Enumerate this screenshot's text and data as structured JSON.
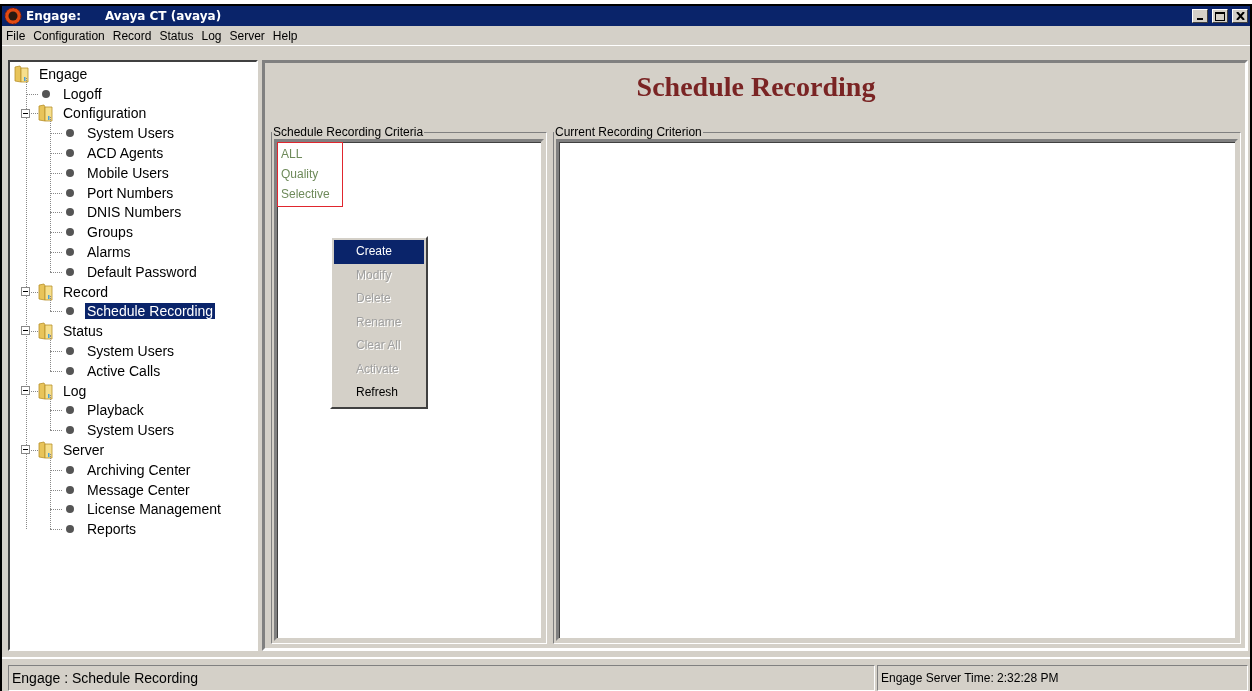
{
  "window": {
    "title": "Engage:",
    "subtitle": "Avaya CT (avaya)"
  },
  "menu": [
    "File",
    "Configuration",
    "Record",
    "Status",
    "Log",
    "Server",
    "Help"
  ],
  "tree": [
    {
      "label": "Engage",
      "kind": "folder",
      "selected": false,
      "children": [
        {
          "label": "Logoff",
          "kind": "leaf",
          "selected": false
        },
        {
          "label": "Configuration",
          "kind": "folder",
          "expanded": true,
          "selected": false,
          "children": [
            {
              "label": "System Users",
              "kind": "leaf",
              "selected": false
            },
            {
              "label": "ACD Agents",
              "kind": "leaf",
              "selected": false
            },
            {
              "label": "Mobile Users",
              "kind": "leaf",
              "selected": false
            },
            {
              "label": "Port Numbers",
              "kind": "leaf",
              "selected": false
            },
            {
              "label": "DNIS Numbers",
              "kind": "leaf",
              "selected": false
            },
            {
              "label": "Groups",
              "kind": "leaf",
              "selected": false
            },
            {
              "label": "Alarms",
              "kind": "leaf",
              "selected": false
            },
            {
              "label": "Default Password",
              "kind": "leaf",
              "selected": false
            }
          ]
        },
        {
          "label": "Record",
          "kind": "folder",
          "expanded": true,
          "selected": false,
          "children": [
            {
              "label": "Schedule Recording",
              "kind": "leaf",
              "selected": true
            }
          ]
        },
        {
          "label": "Status",
          "kind": "folder",
          "expanded": true,
          "selected": false,
          "children": [
            {
              "label": "System Users",
              "kind": "leaf",
              "selected": false
            },
            {
              "label": "Active Calls",
              "kind": "leaf",
              "selected": false
            }
          ]
        },
        {
          "label": "Log",
          "kind": "folder",
          "expanded": true,
          "selected": false,
          "children": [
            {
              "label": "Playback",
              "kind": "leaf",
              "selected": false
            },
            {
              "label": "System Users",
              "kind": "leaf",
              "selected": false
            }
          ]
        },
        {
          "label": "Server",
          "kind": "folder",
          "expanded": true,
          "selected": false,
          "children": [
            {
              "label": "Archiving Center",
              "kind": "leaf",
              "selected": false
            },
            {
              "label": "Message Center",
              "kind": "leaf",
              "selected": false
            },
            {
              "label": "License Management",
              "kind": "leaf",
              "selected": false
            },
            {
              "label": "Reports",
              "kind": "leaf",
              "selected": false
            }
          ]
        }
      ]
    }
  ],
  "page_title": "Schedule Recording",
  "criteria_panel": {
    "legend": "Schedule Recording Criteria",
    "items": [
      "ALL",
      "Quality",
      "Selective"
    ]
  },
  "current_panel": {
    "legend": "Current Recording Criterion"
  },
  "context_menu": [
    {
      "label": "Create",
      "disabled": false,
      "selected": true
    },
    {
      "label": "Modify",
      "disabled": true,
      "selected": false
    },
    {
      "label": "Delete",
      "disabled": true,
      "selected": false
    },
    {
      "label": "Rename",
      "disabled": true,
      "selected": false
    },
    {
      "label": "Clear All",
      "disabled": true,
      "selected": false
    },
    {
      "label": "Activate",
      "disabled": true,
      "selected": false
    },
    {
      "label": "Refresh",
      "disabled": false,
      "selected": false
    }
  ],
  "status_bar": {
    "left": "Engage : Schedule Recording",
    "right": "Engage Server Time: 2:32:28 PM"
  }
}
